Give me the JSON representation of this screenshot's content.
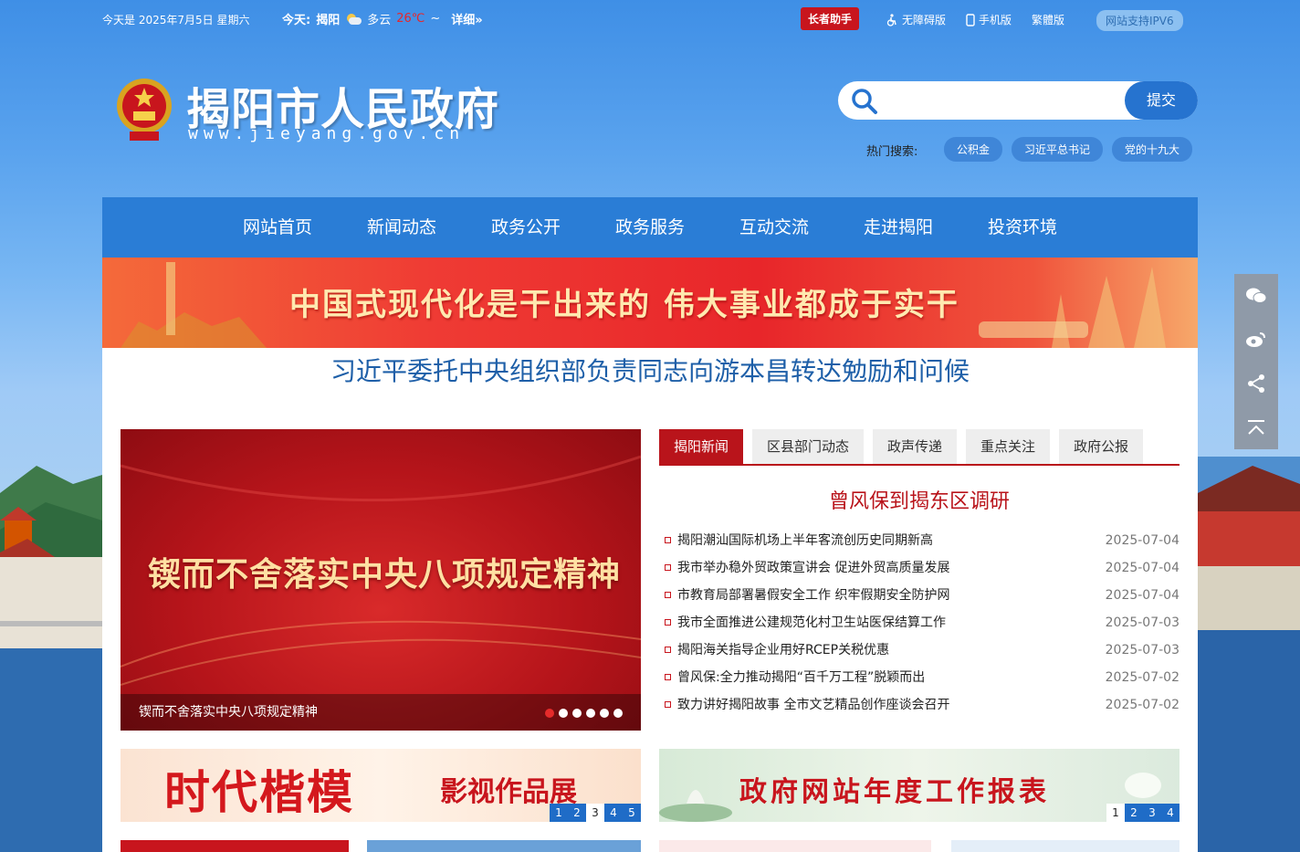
{
  "topbar": {
    "date": "今天是 2025年7月5日 星期六",
    "weather_label": "今天:",
    "city": "揭阳",
    "condition": "多云",
    "temp_high": "26℃",
    "temp_sep": "~",
    "temp_low": "",
    "detail": "详细»",
    "elder_btn": "长者助手",
    "links": [
      "无障碍版",
      "手机版",
      "繁體版"
    ],
    "ipv6": "网站支持IPV6"
  },
  "header": {
    "title": "揭阳市人民政府",
    "url": "www.jieyang.gov.cn"
  },
  "search": {
    "placeholder": "",
    "submit": "提交",
    "hot_label": "热门搜索:",
    "hot_tags": [
      "公积金",
      "习近平总书记",
      "党的十九大"
    ]
  },
  "nav": [
    "网站首页",
    "新闻动态",
    "政务公开",
    "政务服务",
    "互动交流",
    "走进揭阳",
    "投资环境"
  ],
  "banner": {
    "text": "中国式现代化是干出来的   伟大事业都成于实干"
  },
  "headline": "习近平委托中央组织部负责同志向游本昌转达勉励和问候",
  "slider": {
    "main_text": "锲而不舍落实中央八项规定精神",
    "caption": "锲而不舍落实中央八项规定精神",
    "slides": 6,
    "active": 0
  },
  "tabs": [
    "揭阳新闻",
    "区县部门动态",
    "政声传递",
    "重点关注",
    "政府公报"
  ],
  "news": {
    "top_title": "曾风保到揭东区调研",
    "items": [
      {
        "title": "揭阳潮汕国际机场上半年客流创历史同期新高",
        "date": "2025-07-04"
      },
      {
        "title": "我市举办稳外贸政策宣讲会 促进外贸高质量发展",
        "date": "2025-07-04"
      },
      {
        "title": "市教育局部署暑假安全工作 织牢假期安全防护网",
        "date": "2025-07-04"
      },
      {
        "title": "我市全面推进公建规范化村卫生站医保结算工作",
        "date": "2025-07-03"
      },
      {
        "title": "揭阳海关指导企业用好RCEP关税优惠",
        "date": "2025-07-03"
      },
      {
        "title": "曾风保:全力推动揭阳“百千万工程”脱颖而出",
        "date": "2025-07-02"
      },
      {
        "title": "致力讲好揭阳故事 全市文艺精品创作座谈会召开",
        "date": "2025-07-02"
      }
    ]
  },
  "promo1": {
    "big": "时代楷模",
    "small": "影视作品展",
    "pages": [
      "1",
      "2",
      "3",
      "4",
      "5"
    ],
    "active": 2
  },
  "promo2": {
    "big": "政府网站年度工作报表",
    "pages": [
      "1",
      "2",
      "3",
      "4"
    ],
    "active": 0
  },
  "colors": {
    "nav": "#2a7dd6",
    "accent_red": "#b9141b",
    "headline_blue": "#1e5fa8"
  },
  "icons": {
    "side_share": [
      "wechat-icon",
      "weibo-icon",
      "share-icon",
      "back-to-top-icon"
    ]
  }
}
